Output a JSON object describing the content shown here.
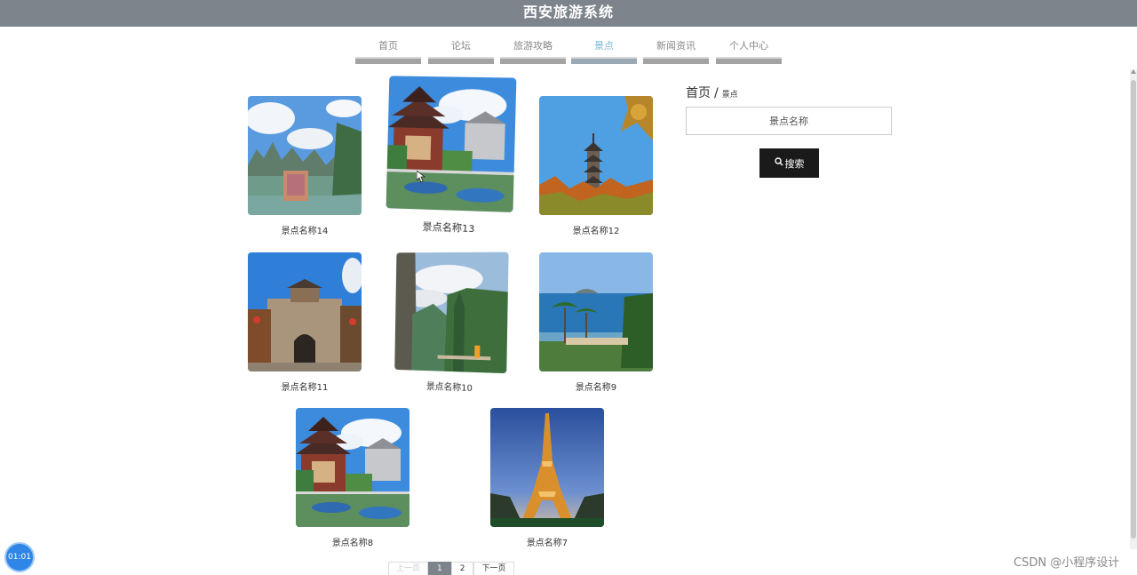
{
  "site": {
    "title": "西安旅游系统"
  },
  "nav": [
    {
      "label": "首页",
      "active": false
    },
    {
      "label": "论坛",
      "active": false
    },
    {
      "label": "旅游攻略",
      "active": false
    },
    {
      "label": "景点",
      "active": true
    },
    {
      "label": "新闻资讯",
      "active": false
    },
    {
      "label": "个人中心",
      "active": false
    }
  ],
  "spots": [
    {
      "name": "景点名称14",
      "scene": "karst-river"
    },
    {
      "name": "景点名称13",
      "scene": "pagoda-pond"
    },
    {
      "name": "景点名称12",
      "scene": "tower-autumn"
    },
    {
      "name": "景点名称11",
      "scene": "city-gate"
    },
    {
      "name": "景点名称10",
      "scene": "cliff-valley"
    },
    {
      "name": "景点名称9",
      "scene": "palm-beach"
    },
    {
      "name": "景点名称8",
      "scene": "pagoda-pond"
    },
    {
      "name": "景点名称7",
      "scene": "eiffel-tower"
    }
  ],
  "sidebar": {
    "breadcrumb_home": "首页",
    "breadcrumb_sep": "/",
    "breadcrumb_current": "景点",
    "search_placeholder": "景点名称",
    "search_button": "搜索",
    "search_icon": "search-icon"
  },
  "pagination": {
    "prev": "上一页",
    "pages": [
      "1",
      "2"
    ],
    "current": "1",
    "next": "下一页"
  },
  "overlay": {
    "timer": "01:01",
    "watermark": "CSDN @小程序设计"
  },
  "colors": {
    "header": "#7d848c",
    "nav_active": "#7fb9d3",
    "search_button": "#1a1a1a",
    "timer": "#2f86e6"
  }
}
